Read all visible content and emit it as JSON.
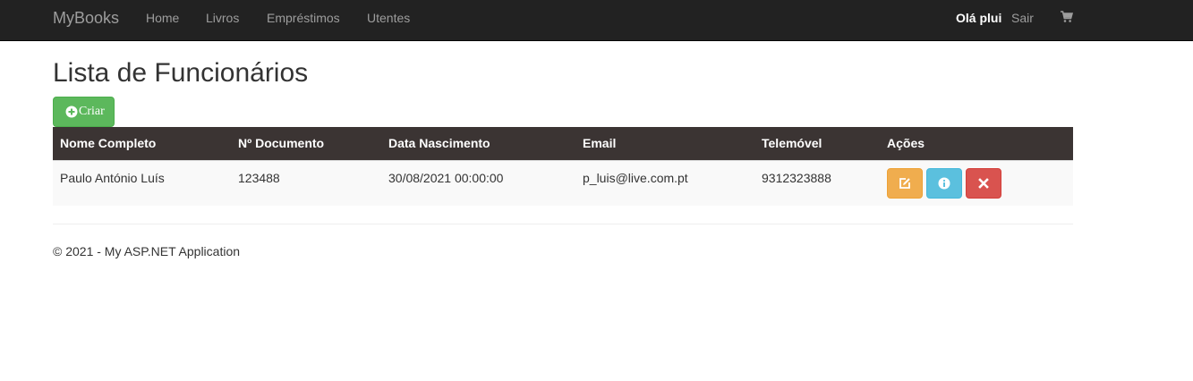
{
  "navbar": {
    "brand": "MyBooks",
    "links": [
      "Home",
      "Livros",
      "Empréstimos",
      "Utentes"
    ],
    "greeting": "Olá plui",
    "logout": "Sair",
    "cart_icon": "shopping-cart-icon"
  },
  "page": {
    "title": "Lista de Funcionários",
    "create_button": "Criar",
    "create_icon": "plus-circle-icon"
  },
  "table": {
    "headers": [
      "Nome Completo",
      "Nº Documento",
      "Data Nascimento",
      "Email",
      "Telemóvel",
      "Ações"
    ],
    "rows": [
      {
        "name": "Paulo António Luís",
        "document": "123488",
        "birth_date": "30/08/2021 00:00:00",
        "email": "p_luis@live.com.pt",
        "phone": "9312323888",
        "actions": [
          "edit-icon",
          "info-icon",
          "delete-icon"
        ]
      }
    ]
  },
  "footer": {
    "text": "© 2021 - My ASP.NET Application"
  },
  "colors": {
    "navbar_bg": "#222222",
    "header_bg": "#3b3433",
    "success": "#5cb85c",
    "warning": "#f0ad4e",
    "info": "#5bc0de",
    "danger": "#d9534f"
  }
}
